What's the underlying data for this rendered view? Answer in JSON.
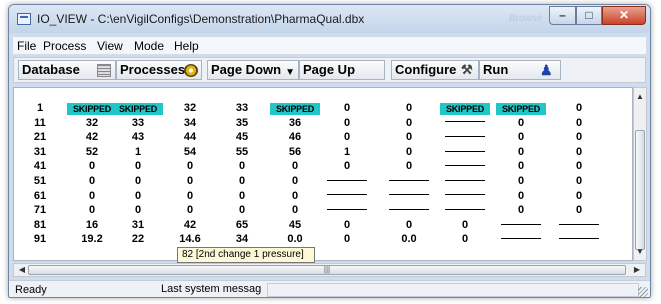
{
  "window": {
    "title": "IO_VIEW - C:\\enVigilConfigs\\Demonstration\\PharmaQual.dbx",
    "background_label": "Browse"
  },
  "menu": [
    "File",
    "Process",
    "View",
    "Mode",
    "Help"
  ],
  "toolbar": {
    "database": "Database",
    "processes": "Processes",
    "page_down": "Page Down",
    "page_up": "Page Up",
    "configure": "Configure",
    "run": "Run"
  },
  "table": {
    "skipped_color": "#21c6c6",
    "rows": [
      [
        "1",
        "SKIPPED",
        "SKIPPED",
        "32",
        "33",
        "SKIPPED",
        "0",
        "0",
        "SKIPPED",
        "SKIPPED",
        "0"
      ],
      [
        "11",
        "32",
        "33",
        "34",
        "35",
        "36",
        "0",
        "0",
        "—",
        "0",
        "0"
      ],
      [
        "21",
        "42",
        "43",
        "44",
        "45",
        "46",
        "0",
        "0",
        "—",
        "0",
        "0"
      ],
      [
        "31",
        "52",
        "1",
        "54",
        "55",
        "56",
        "1",
        "0",
        "—",
        "0",
        "0"
      ],
      [
        "41",
        "0",
        "0",
        "0",
        "0",
        "0",
        "0",
        "0",
        "—",
        "0",
        "0"
      ],
      [
        "51",
        "0",
        "0",
        "0",
        "0",
        "0",
        "—",
        "—",
        "—",
        "0",
        "0"
      ],
      [
        "61",
        "0",
        "0",
        "0",
        "0",
        "0",
        "—",
        "—",
        "—",
        "0",
        "0"
      ],
      [
        "71",
        "0",
        "0",
        "0",
        "0",
        "0",
        "—",
        "—",
        "—",
        "0",
        "0"
      ],
      [
        "81",
        "16",
        "31",
        "42",
        "65",
        "45",
        "0",
        "0",
        "0",
        "—",
        "—"
      ],
      [
        "91",
        "19.2",
        "22",
        "14.6",
        "34",
        "0.0",
        "0",
        "0.0",
        "0",
        "—",
        "—"
      ]
    ]
  },
  "tooltip": "82 [2nd change 1 pressure]",
  "status": {
    "ready": "Ready",
    "message": "Last system messag"
  }
}
